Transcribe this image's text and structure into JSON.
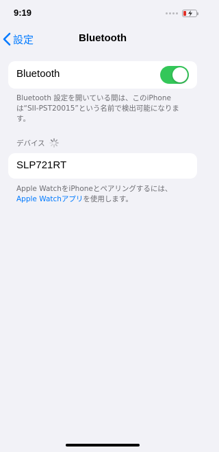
{
  "status_bar": {
    "time": "9:19",
    "battery_color": "#e0322a"
  },
  "nav": {
    "back_label": "設定",
    "title": "Bluetooth",
    "back_icon": "chevron-left-icon"
  },
  "bluetooth": {
    "label": "Bluetooth",
    "enabled": true,
    "toggle_color": "#34c759",
    "footnote": "Bluetooth 設定を開いている間は、このiPhoneは“SII-PST20015”という名前で検出可能になります。"
  },
  "devices": {
    "header": "デバイス",
    "loading_icon": "spinner-icon",
    "items": [
      {
        "name": "SLP721RT"
      }
    ]
  },
  "watch_footnote": {
    "prefix": "Apple WatchをiPhoneとペアリングするには、",
    "link": "Apple Watchアプリ",
    "suffix": "を使用します。",
    "link_color": "#007aff"
  }
}
